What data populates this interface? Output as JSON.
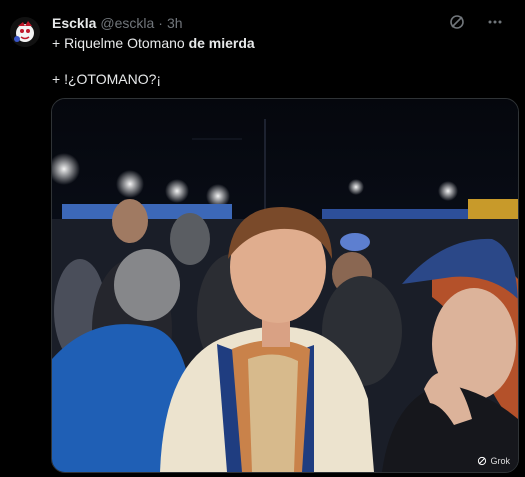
{
  "post": {
    "author": {
      "display_name": "Esckla",
      "handle": "@esckla",
      "separator": "·",
      "time": "3h"
    },
    "text": {
      "line1_plain": "+ Riquelme Otomano ",
      "line1_bold": "de mierda",
      "line2": "+ !¿OTOMANO?¡"
    },
    "media": {
      "badge_label": "Grok"
    }
  },
  "icons": {
    "grok": "grok-icon",
    "more": "more-icon"
  },
  "colors": {
    "background": "#000000",
    "text_primary": "#e7e9ea",
    "text_secondary": "#71767b",
    "border": "#2f3336"
  }
}
